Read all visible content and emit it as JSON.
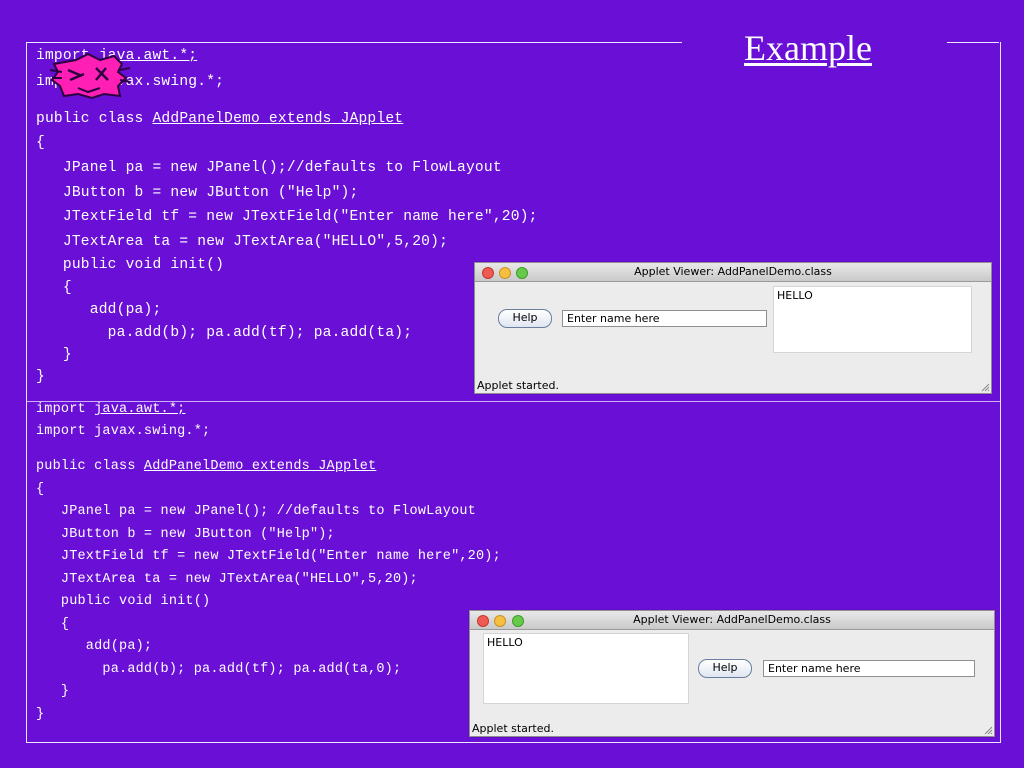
{
  "title": "Example",
  "colors": {
    "background": "#6a0fd6",
    "text": "#ffffff",
    "sticker": "#ff1fb4"
  },
  "code_top": {
    "l1_kw": "import ",
    "l1_pkg": "java.awt.*;",
    "l2": "import javax.swing.*;",
    "l3_kw": "public class ",
    "l3_cls": "AddPanelDemo extends JApplet",
    "l4": "{",
    "l5": "   JPanel pa = new JPanel();//defaults to FlowLayout",
    "l6": "   JButton b = new JButton (\"Help\");",
    "l7": "   JTextField tf = new JTextField(\"Enter name here\",20);",
    "l8": "   JTextArea ta = new JTextArea(\"HELLO\",5,20);",
    "l9": "   public void init()",
    "l10": "   {",
    "l11": "      add(pa);",
    "l12": "        pa.add(b); pa.add(tf); pa.add(ta);",
    "l13": "   }",
    "l14": "}"
  },
  "code_bottom": {
    "l1_kw": "import ",
    "l1_pkg": "java.awt.*;",
    "l2": "import javax.swing.*;",
    "l3_kw": "public class ",
    "l3_cls": "AddPanelDemo extends JApplet",
    "l4": "{",
    "l5": "   JPanel pa = new JPanel(); //defaults to FlowLayout",
    "l6": "   JButton b = new JButton (\"Help\");",
    "l7": "   JTextField tf = new JTextField(\"Enter name here\",20);",
    "l8": "   JTextArea ta = new JTextArea(\"HELLO\",5,20);",
    "l9": "   public void init()",
    "l10": "   {",
    "l11": "      add(pa);",
    "l12": "        pa.add(b); pa.add(tf); pa.add(ta,0);",
    "l13": "   }",
    "l14": "}"
  },
  "applet_top": {
    "window_title": "Applet Viewer: AddPanelDemo.class",
    "button_label": "Help",
    "textfield_value": "Enter name here",
    "textarea_value": "HELLO",
    "status": "Applet started."
  },
  "applet_bottom": {
    "window_title": "Applet Viewer: AddPanelDemo.class",
    "button_label": "Help",
    "textfield_value": "Enter name here",
    "textarea_value": "HELLO",
    "status": "Applet started."
  }
}
